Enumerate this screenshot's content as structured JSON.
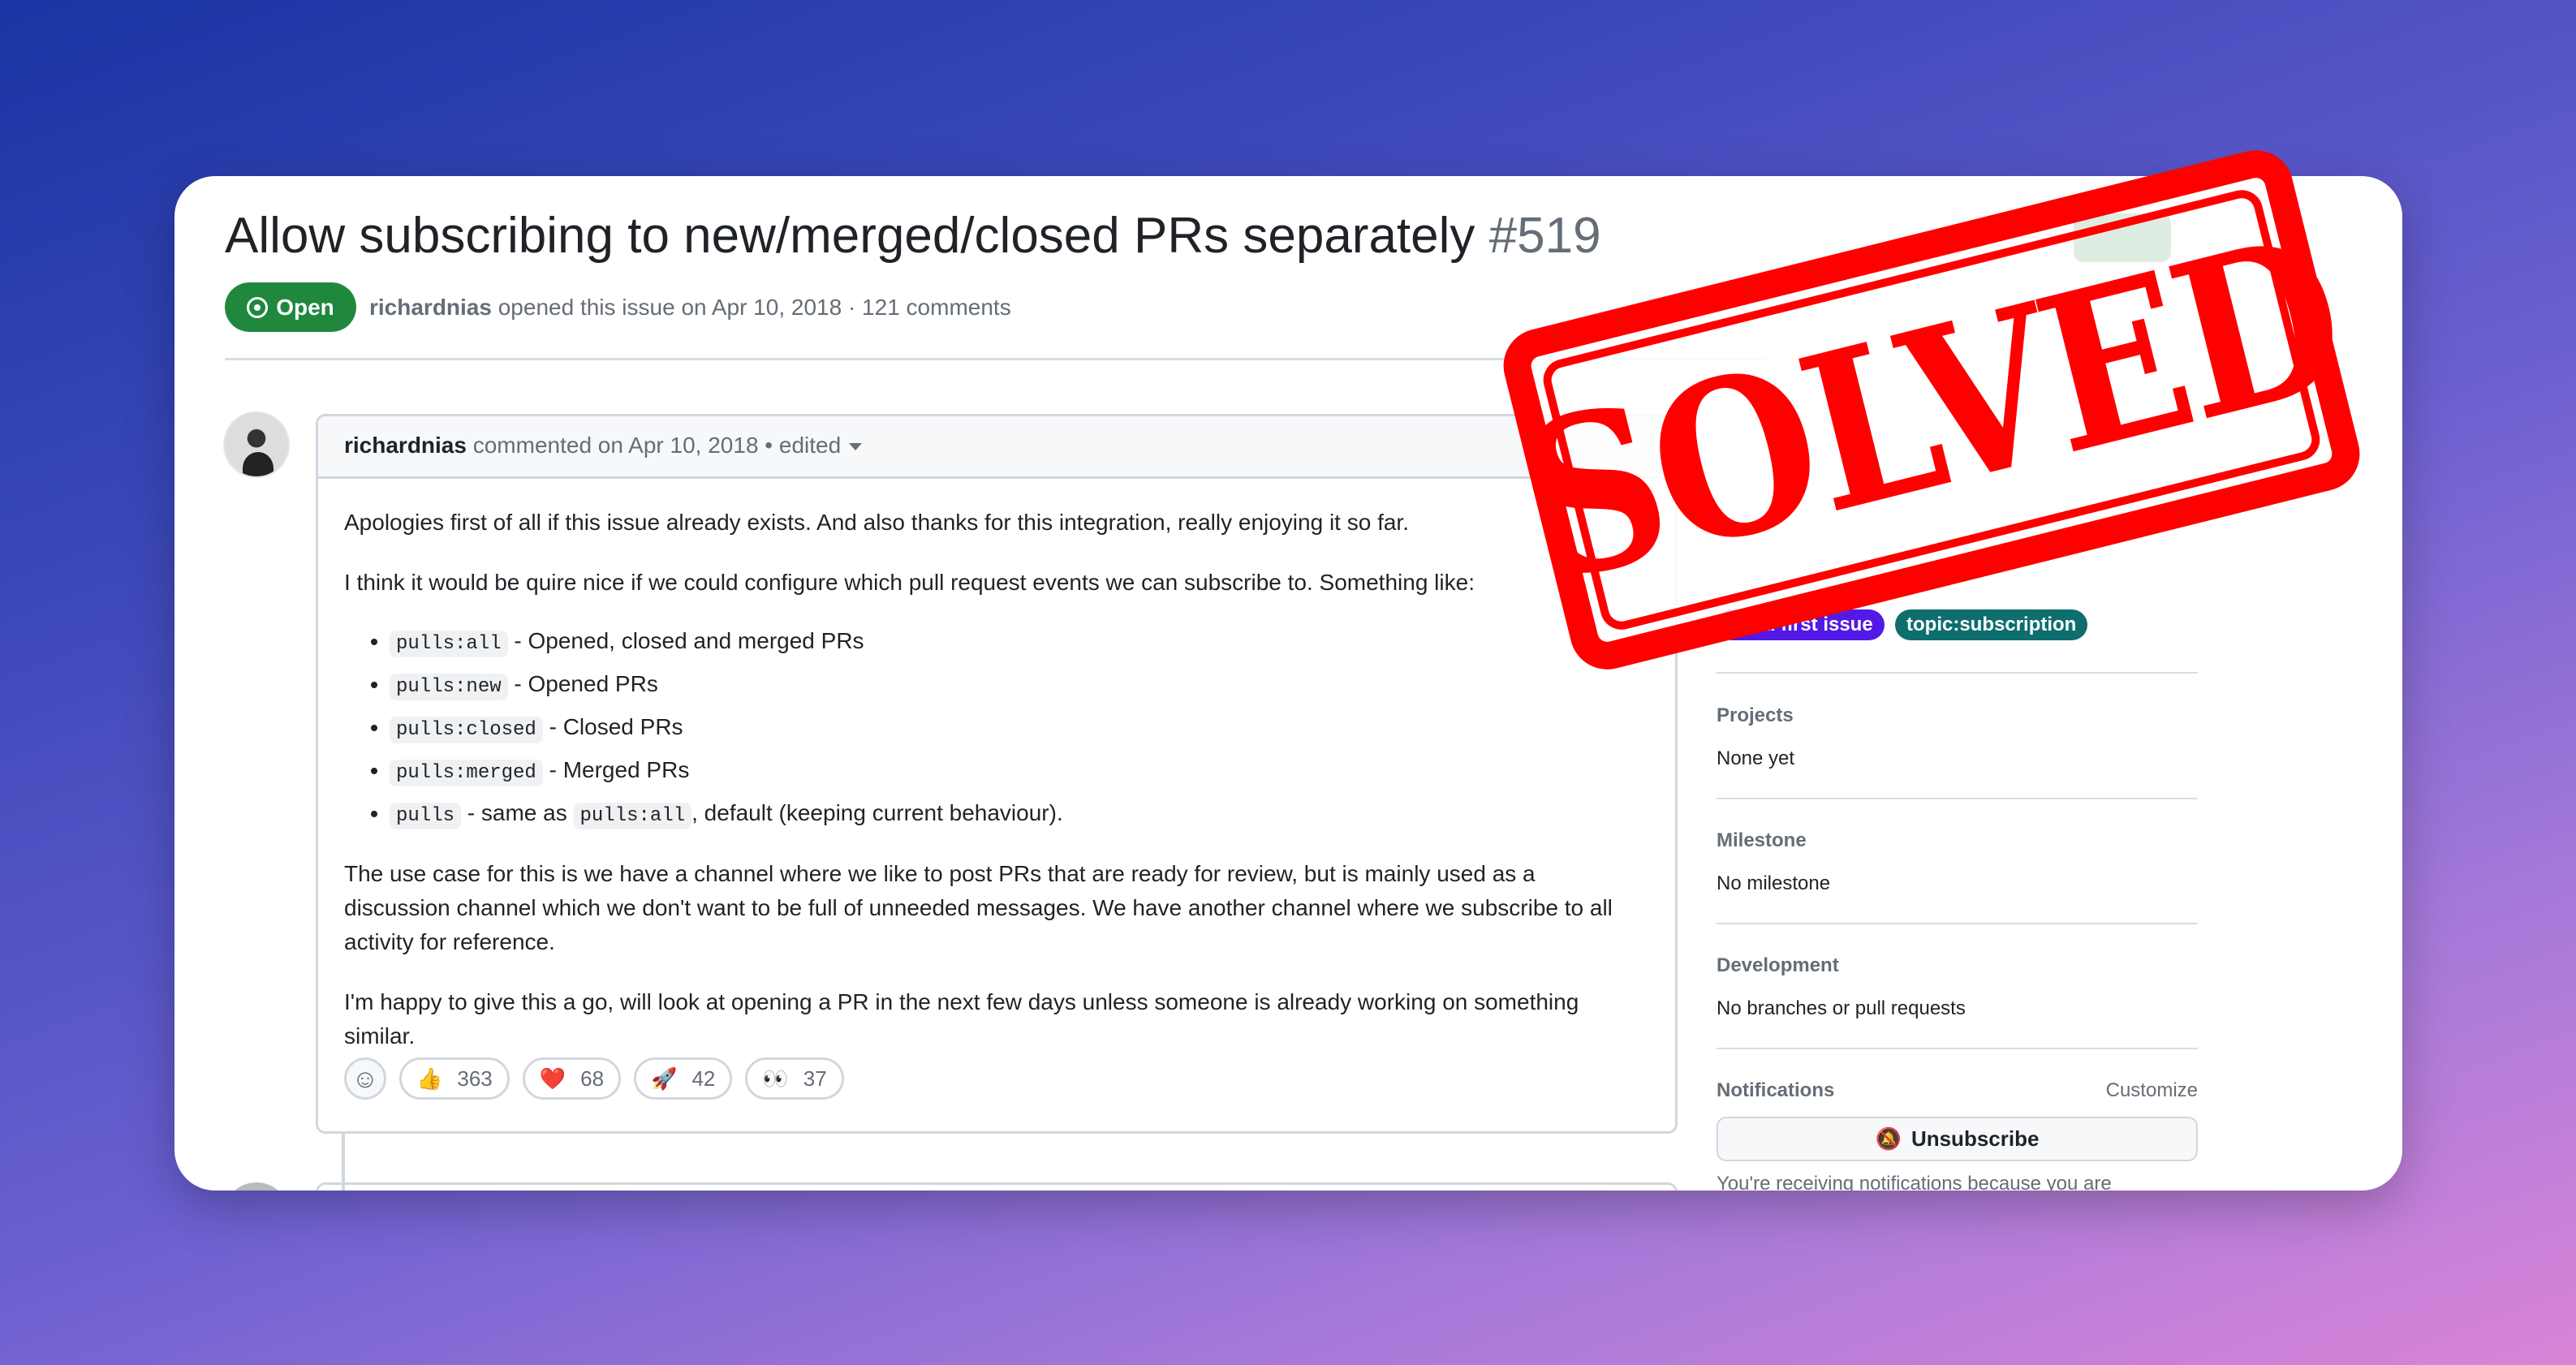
{
  "issue": {
    "title": "Allow subscribing to new/merged/closed PRs separately",
    "number": "#519",
    "state": "Open",
    "author": "richardnias",
    "meta": " opened this issue on Apr 10, 2018 · 121 comments",
    "state_color": "#1f883d"
  },
  "comment": {
    "author": "richardnias",
    "meta": " commented on Apr 10, 2018 • edited",
    "p1": "Apologies first of all if this issue already exists. And also thanks for this integration, really enjoying it so far.",
    "p2": "I think it would be quire nice if we could configure which pull request events we can subscribe to. Something like:",
    "items": [
      {
        "code": "pulls:all",
        "text": " - Opened, closed and merged PRs"
      },
      {
        "code": "pulls:new",
        "text": " - Opened PRs"
      },
      {
        "code": "pulls:closed",
        "text": " - Closed PRs"
      },
      {
        "code": "pulls:merged",
        "text": " - Merged PRs"
      },
      {
        "code": "pulls",
        "text": " - same as ",
        "code2": "pulls:all",
        "text2": ", default (keeping current behaviour)."
      }
    ],
    "p3": "The use case for this is we have a channel where we like to post PRs that are ready for review, but is mainly used as a discussion channel which we don't want to be full of unneeded messages. We have another channel where we subscribe to all activity for reference.",
    "p4": "I'm happy to give this a go, will look at opening a PR in the next few days unless someone is already working on something similar.",
    "reactions": [
      {
        "emoji": "👍",
        "count": "363"
      },
      {
        "emoji": "❤️",
        "count": "68"
      },
      {
        "emoji": "🚀",
        "count": "42"
      },
      {
        "emoji": "👀",
        "count": "37"
      }
    ]
  },
  "sidebar": {
    "labels": [
      {
        "text": "good first issue",
        "color": "#5319e7"
      },
      {
        "text": "topic:subscription",
        "color": "#0e6e6e"
      }
    ],
    "projects": {
      "heading": "Projects",
      "value": "None yet"
    },
    "milestone": {
      "heading": "Milestone",
      "value": "No milestone"
    },
    "development": {
      "heading": "Development",
      "value": "No branches or pull requests"
    },
    "notifications": {
      "heading": "Notifications",
      "customize": "Customize",
      "button": "Unsubscribe",
      "note": "You're receiving notifications because you are"
    }
  },
  "stamp": {
    "text": "SOLVED",
    "color": "#ff0000"
  }
}
